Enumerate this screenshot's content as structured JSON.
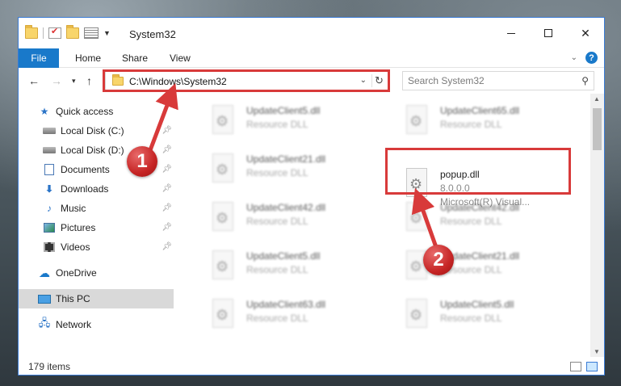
{
  "window": {
    "title": "System32",
    "controls": {
      "minimize": "minimize",
      "maximize": "maximize",
      "close": "✕"
    }
  },
  "ribbon": {
    "tabs": [
      {
        "label": "File"
      },
      {
        "label": "Home"
      },
      {
        "label": "Share"
      },
      {
        "label": "View"
      }
    ]
  },
  "navbar": {
    "address": "C:\\Windows\\System32",
    "search_placeholder": "Search System32"
  },
  "sidebar": {
    "items": [
      {
        "label": "Quick access",
        "icon": "star-icon"
      },
      {
        "label": "Local Disk (C:)",
        "icon": "drive-icon",
        "pinned": true
      },
      {
        "label": "Local Disk (D:)",
        "icon": "drive-icon",
        "pinned": true
      },
      {
        "label": "Documents",
        "icon": "documents-icon",
        "pinned": true
      },
      {
        "label": "Downloads",
        "icon": "downloads-icon",
        "pinned": true
      },
      {
        "label": "Music",
        "icon": "music-icon",
        "pinned": true
      },
      {
        "label": "Pictures",
        "icon": "pictures-icon",
        "pinned": true
      },
      {
        "label": "Videos",
        "icon": "videos-icon",
        "pinned": true
      },
      {
        "label": "OneDrive",
        "icon": "onedrive-icon"
      },
      {
        "label": "This PC",
        "icon": "this-pc-icon",
        "selected": true
      },
      {
        "label": "Network",
        "icon": "network-icon"
      }
    ]
  },
  "files": {
    "left": [
      {
        "name": "UpdateClient5.dll",
        "type": "Resource DLL"
      },
      {
        "name": "UpdateClient21.dll",
        "type": "Resource DLL"
      },
      {
        "name": "UpdateClient42.dll",
        "type": "Resource DLL"
      },
      {
        "name": "UpdateClient5.dll",
        "type": "Resource DLL"
      },
      {
        "name": "UpdateClient63.dll",
        "type": "Resource DLL"
      }
    ],
    "right": [
      {
        "name": "UpdateClient65.dll",
        "type": "Resource DLL"
      },
      {
        "name": "popup.dll",
        "version": "8.0.0.0",
        "company": "Microsoft(R) Visual..."
      },
      {
        "name": "UpdateClient42.dll",
        "type": "Resource DLL"
      },
      {
        "name": "UpdateClient21.dll",
        "type": "Resource DLL"
      },
      {
        "name": "UpdateClient5.dll",
        "type": "Resource DLL"
      }
    ]
  },
  "status": {
    "item_count": "179 items"
  },
  "annotations": {
    "step1": "1",
    "step2": "2",
    "color": "#d83a3a"
  }
}
